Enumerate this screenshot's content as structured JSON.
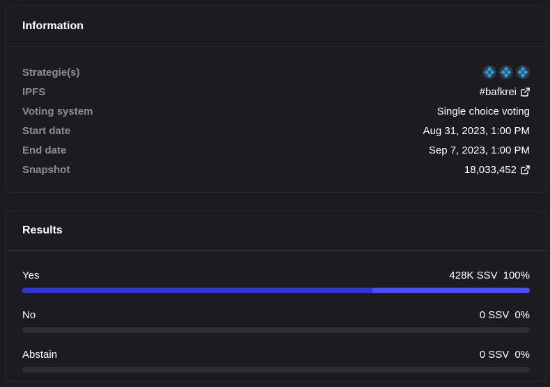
{
  "information": {
    "title": "Information",
    "rows": [
      {
        "label": "Strategie(s)",
        "value": "",
        "type": "strategies"
      },
      {
        "label": "IPFS",
        "value": "#bafkrei",
        "type": "link"
      },
      {
        "label": "Voting system",
        "value": "Single choice voting",
        "type": "text"
      },
      {
        "label": "Start date",
        "value": "Aug 31, 2023, 1:00 PM",
        "type": "text"
      },
      {
        "label": "End date",
        "value": "Sep 7, 2023, 1:00 PM",
        "type": "text"
      },
      {
        "label": "Snapshot",
        "value": "18,033,452",
        "type": "link"
      }
    ],
    "strategy_icons": [
      "strategy-icon",
      "strategy-icon",
      "strategy-icon"
    ],
    "strategy_color": "#2d9cdb"
  },
  "results": {
    "title": "Results",
    "items": [
      {
        "label": "Yes",
        "amount": "428K SSV",
        "percent": "100%",
        "fill": 1.0,
        "shade": 0.69
      },
      {
        "label": "No",
        "amount": "0 SSV",
        "percent": "0%",
        "fill": 0.0,
        "shade": 0.0
      },
      {
        "label": "Abstain",
        "amount": "0 SSV",
        "percent": "0%",
        "fill": 0.0,
        "shade": 0.0
      }
    ],
    "bar_color": "#4e4ef0"
  }
}
